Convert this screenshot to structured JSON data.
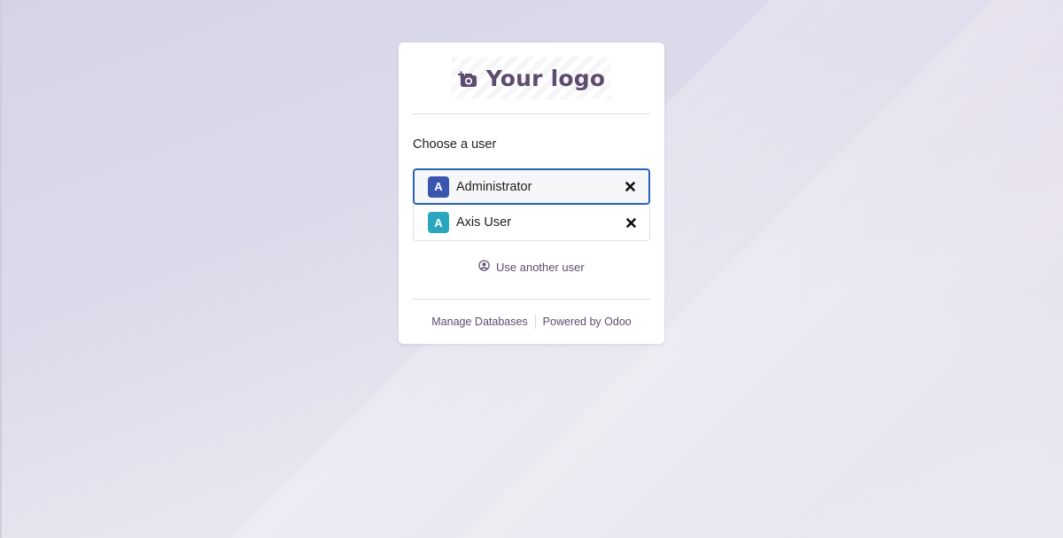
{
  "brand": {
    "logo_text": "Your logo",
    "logo_icon": "camera-plus-icon",
    "accent_color": "#5e4b70",
    "selected_border_color": "#2a62b8"
  },
  "login": {
    "choose_label": "Choose a user",
    "users": [
      {
        "initial": "A",
        "name": "Administrator",
        "avatar_color": "#3a55b0",
        "selected": true
      },
      {
        "initial": "A",
        "name": "Axis User",
        "avatar_color": "#2aa7bf",
        "selected": false
      }
    ],
    "another_user_label": "Use another user",
    "another_user_icon": "user-circle-icon"
  },
  "footer": {
    "manage_databases": "Manage Databases",
    "powered_by": "Powered by Odoo"
  }
}
